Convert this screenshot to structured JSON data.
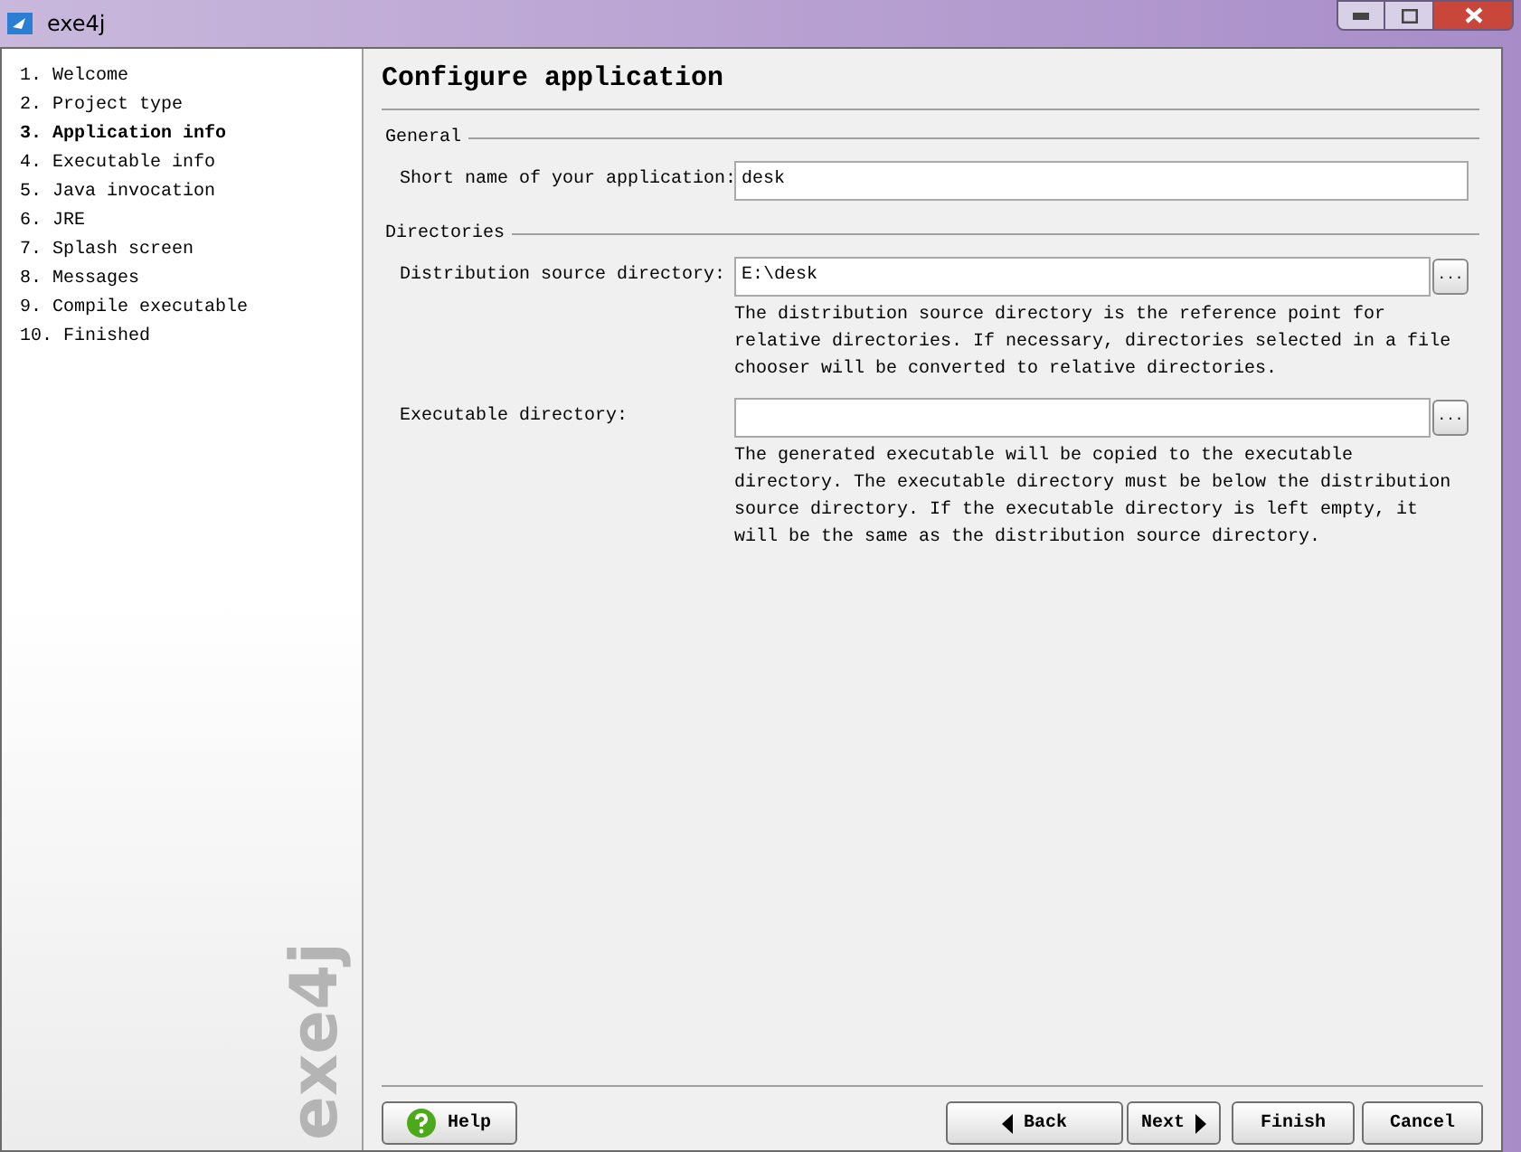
{
  "window": {
    "title": "exe4j"
  },
  "steps": [
    {
      "number": "1.",
      "label": "Welcome",
      "selected": false
    },
    {
      "number": "2.",
      "label": "Project type",
      "selected": false
    },
    {
      "number": "3.",
      "label": "Application info",
      "selected": true
    },
    {
      "number": "4.",
      "label": "Executable info",
      "selected": false
    },
    {
      "number": "5.",
      "label": "Java invocation",
      "selected": false
    },
    {
      "number": "6.",
      "label": "JRE",
      "selected": false
    },
    {
      "number": "7.",
      "label": "Splash screen",
      "selected": false
    },
    {
      "number": "8.",
      "label": "Messages",
      "selected": false
    },
    {
      "number": "9.",
      "label": "Compile executable",
      "selected": false
    },
    {
      "number": "10.",
      "label": "Finished",
      "selected": false
    }
  ],
  "sidebar_logo": "exe4j",
  "page_title": "Configure application",
  "sections": [
    {
      "title": "General",
      "fields": [
        {
          "label": "Short name of your application:",
          "value": "desk"
        }
      ]
    },
    {
      "title": "Directories",
      "fields": [
        {
          "label": "Distribution source directory:",
          "value": "E:\\desk",
          "browse_label": "...",
          "help": "The distribution source directory is the reference point for relative directories. If necessary, directories selected in a file chooser will be converted to relative directories."
        },
        {
          "label": "Executable directory:",
          "browse_label": "...",
          "help": "The generated executable will be copied to the executable directory. The executable directory must be below the distribution source directory. If the executable directory is left empty, it will be the same as the distribution source directory."
        }
      ]
    }
  ],
  "buttons": [
    {
      "kind": "help",
      "label": "Help"
    },
    {
      "kind": "back",
      "label": "Back"
    },
    {
      "kind": "next",
      "label": "Next"
    },
    {
      "kind": "finish",
      "label": "Finish"
    },
    {
      "kind": "cancel",
      "label": "Cancel"
    }
  ]
}
